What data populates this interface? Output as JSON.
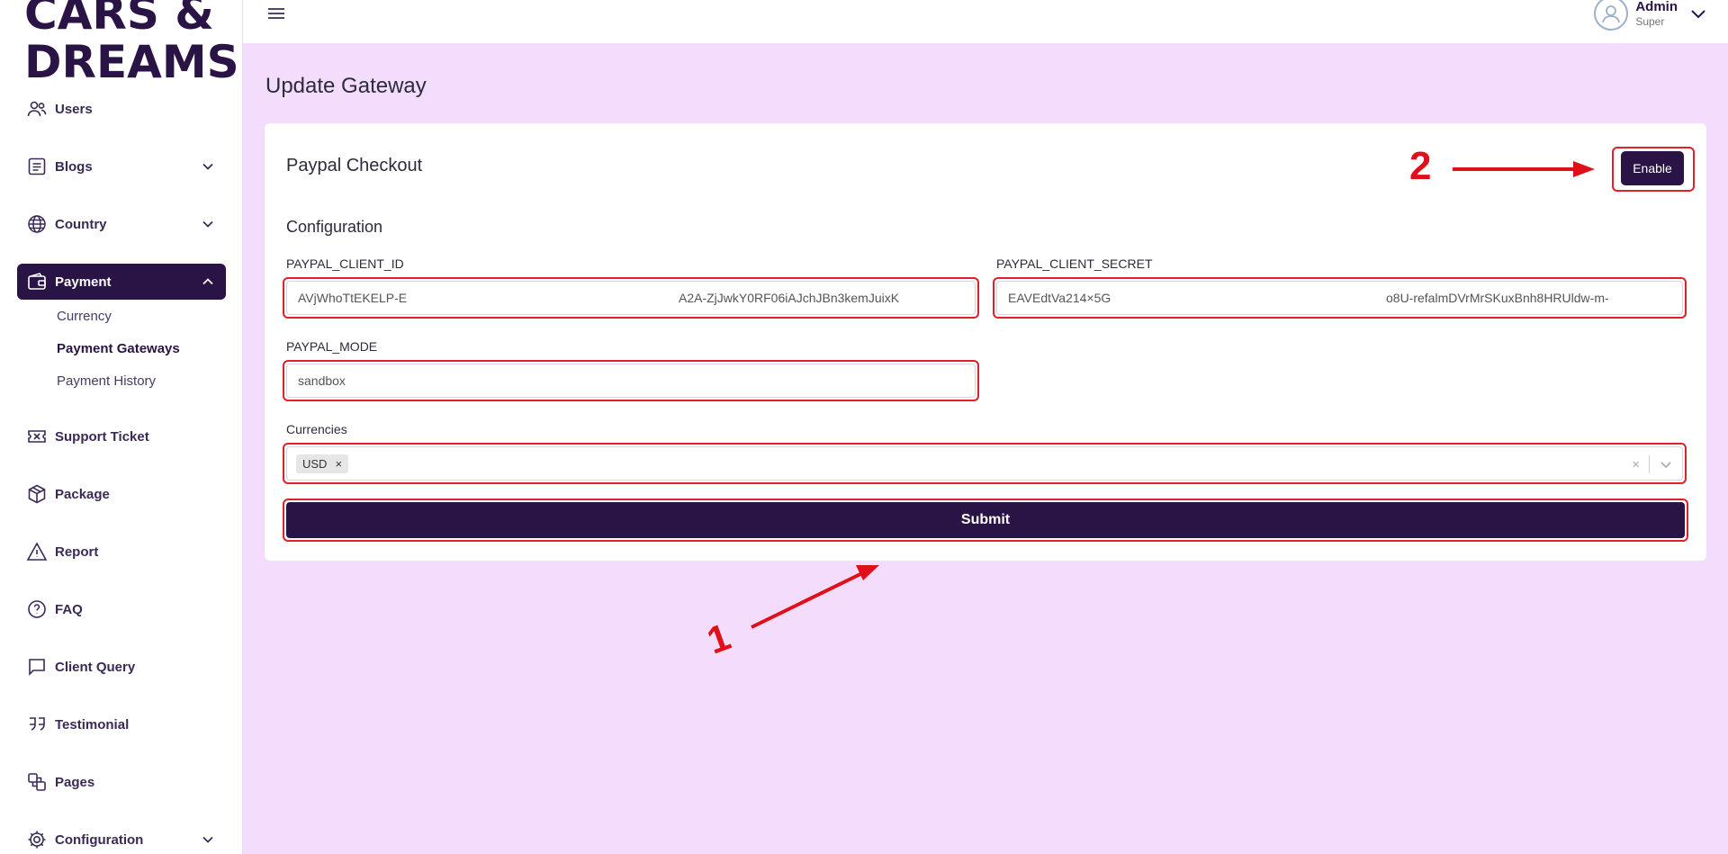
{
  "sidebar": {
    "logo_line1": "CARS &",
    "logo_line2": "DREAMS",
    "items": [
      {
        "label": "Users",
        "icon": "users-icon"
      },
      {
        "label": "Blogs",
        "icon": "document-icon"
      },
      {
        "label": "Country",
        "icon": "globe-icon"
      },
      {
        "label": "Payment",
        "icon": "wallet-icon"
      },
      {
        "label": "Support Ticket",
        "icon": "ticket-icon"
      },
      {
        "label": "Package",
        "icon": "package-icon"
      },
      {
        "label": "Report",
        "icon": "warning-icon"
      },
      {
        "label": "FAQ",
        "icon": "question-icon"
      },
      {
        "label": "Client Query",
        "icon": "chat-icon"
      },
      {
        "label": "Testimonial",
        "icon": "quote-icon"
      },
      {
        "label": "Pages",
        "icon": "pages-icon"
      },
      {
        "label": "Configuration",
        "icon": "gear-icon"
      }
    ],
    "payment_sub": [
      "Currency",
      "Payment Gateways",
      "Payment History"
    ]
  },
  "topbar": {
    "admin_name": "Admin",
    "admin_role": "Super"
  },
  "page": {
    "title": "Update Gateway"
  },
  "gateway": {
    "title": "Paypal Checkout",
    "enable_label": "Enable",
    "config_title": "Configuration",
    "client_id_label": "PAYPAL_CLIENT_ID",
    "client_id_visible_start": "AVjWhoTtEKELP-E",
    "client_id_visible_end": "A2A-ZjJwkY0RF06iAJchJBn3kemJuixK",
    "client_secret_label": "PAYPAL_CLIENT_SECRET",
    "client_secret_visible_start": "EAVEdtVa214×5G",
    "client_secret_visible_end": "o8U-refalmDVrMrSKuxBnh8HRUldw-m-",
    "mode_label": "PAYPAL_MODE",
    "mode_value": "sandbox",
    "currencies_label": "Currencies",
    "currency_tag": "USD",
    "tag_remove": "×",
    "clear_symbol": "×",
    "submit_label": "Submit"
  },
  "annotations": {
    "one": "1",
    "two": "2"
  },
  "colors": {
    "brand": "#2a1446",
    "background": "#f4dcfd",
    "annotation": "#e0101a"
  }
}
